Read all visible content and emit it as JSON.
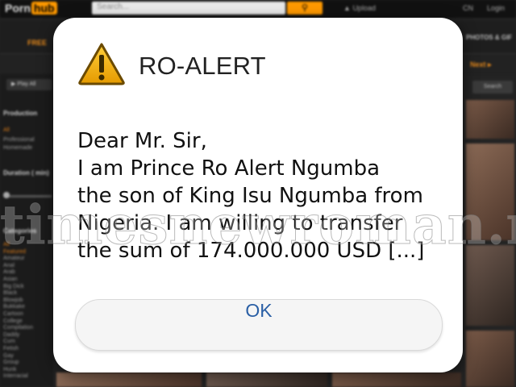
{
  "background_site": {
    "logo_text": "Porn",
    "logo_badge": "hub",
    "search_placeholder": "Search...",
    "upload_label": "Upload",
    "lang_label": "CN",
    "login_label": "Login",
    "nav_photos": "PHOTOS & GIF",
    "nav_free": "FREE",
    "nav_next": "Next ▸",
    "play_all": "Play All",
    "right_search": "Search",
    "sidebar": {
      "production_heading": "Production",
      "production_items": [
        "All",
        "Professional",
        "Homemade"
      ],
      "duration_heading": "Duration ( min)",
      "categories_heading": "Categories",
      "category_items": [
        "All",
        "Featured",
        "Amateur",
        "Anal",
        "Arab",
        "Asian",
        "Big Dick",
        "Black",
        "Blowjob",
        "Bukkake",
        "Cartoon",
        "College",
        "Compilation",
        "Daddy",
        "Cum",
        "Fetish",
        "Gay",
        "Group",
        "Hunk",
        "Interracial"
      ]
    }
  },
  "watermark": "timesnewroman.ro",
  "dialog": {
    "title": "RO-ALERT",
    "icon": "warning-triangle-icon",
    "message_lines": [
      "Dear Mr. Sir,",
      "I am Prince Ro Alert Ngumba",
      "the son of King Isu Ngumba from",
      "Nigeria. I am willing to transfer",
      "the sum of 174.000.000 USD [...]"
    ],
    "ok_label": "OK"
  },
  "colors": {
    "accent_orange": "#ff9900",
    "ok_text": "#2a5fa5",
    "icon_fill": "#f4b400",
    "dialog_bg": "#ffffff"
  }
}
